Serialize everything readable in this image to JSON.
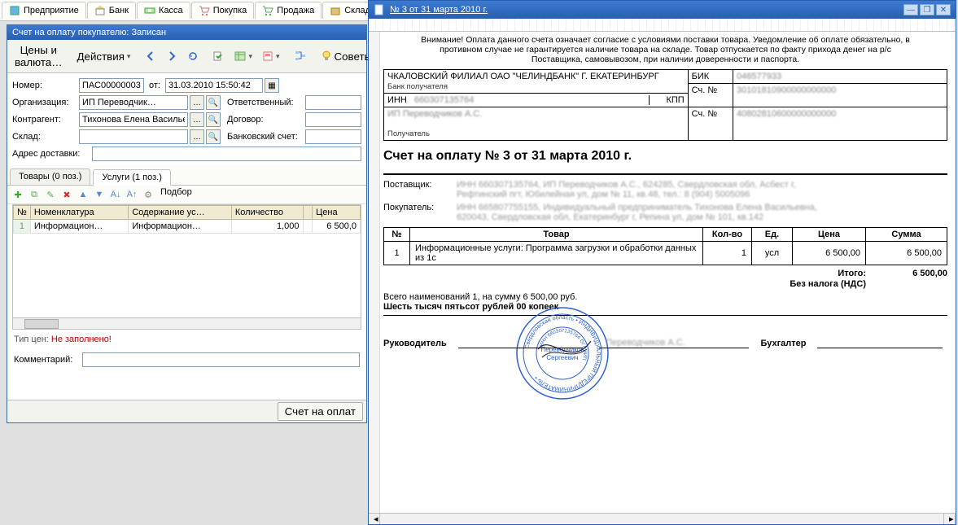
{
  "topTabs": [
    {
      "label": "Предприятие",
      "icon": "building-icon"
    },
    {
      "label": "Банк",
      "icon": "bank-icon"
    },
    {
      "label": "Касса",
      "icon": "cash-icon"
    },
    {
      "label": "Покупка",
      "icon": "cart-icon"
    },
    {
      "label": "Продажа",
      "icon": "sell-icon"
    },
    {
      "label": "Склад",
      "icon": "warehouse-icon"
    }
  ],
  "leftWindow": {
    "title": "Счет на оплату покупателю: Записан",
    "toolbar": {
      "prices": "Цены и валюта…",
      "actions": "Действия",
      "advice": "Советы"
    },
    "form": {
      "numberLabel": "Номер:",
      "numberValue": "ПАС00000003",
      "otLabel": "от:",
      "dateValue": "31.03.2010 15:50:42",
      "orgLabel": "Организация:",
      "orgValue": "ИП Переводчик…",
      "responsibleLabel": "Ответственный:",
      "contragentLabel": "Контрагент:",
      "contragentValue": "Тихонова Елена Васильевна ИП",
      "contractLabel": "Договор:",
      "warehouseLabel": "Склад:",
      "bankAccLabel": "Банковский счет:",
      "addressLabel": "Адрес доставки:"
    },
    "subtabs": {
      "goods": "Товары (0 поз.)",
      "services": "Услуги (1 поз.)"
    },
    "gridToolbar": {
      "selection": "Подбор"
    },
    "gridHeaders": [
      "№",
      "Номенклатура",
      "Содержание ус…",
      "Количество",
      "",
      "Цена"
    ],
    "gridRow": {
      "n": "1",
      "nomen": "Информацион…",
      "content": "Информацион…",
      "qty": "1,000",
      "blank": "",
      "price": "6 500,0"
    },
    "priceTypeLabel": "Тип цен:",
    "priceTypeValue": "Не заполнено!",
    "commentLabel": "Комментарий:",
    "printBtn": "Счет на оплат"
  },
  "rightWindow": {
    "title": "№ 3 от 31 марта 2010 г.",
    "disclaimer": "Внимание! Оплата данного счета означает согласие с условиями поставки товара. Уведомление об оплате обязательно, в противном случае не гарантируется наличие товара на складе. Товар отпускается по факту прихода денег на р/с Поставщика, самовывозом, при наличии доверенности и паспорта.",
    "bank": {
      "bankName": "ЧКАЛОВСКИЙ ФИЛИАЛ ОАО \"ЧЕЛИНДБАНК\" Г. ЕКАТЕРИНБУРГ",
      "bankLabel": "Банк получателя",
      "bikLabel": "БИК",
      "bikValue": "046577933",
      "accLabel": "Сч. №",
      "accValue1": "30101810900000000000",
      "innLabel": "ИНН",
      "innValue": "660307135764",
      "kppLabel": "КПП",
      "accValue2": "40802810600000000000",
      "recipient": "ИП Переводчиков А.С.",
      "recipientLabel": "Получатель"
    },
    "docTitle": "Счет на оплату № 3 от 31 марта 2010 г.",
    "supplier": {
      "label": "Поставщик:",
      "line1": "ИНН 660307135764, ИП Переводчиков А.С., 624285, Свердловская обл, Асбест г,",
      "line2": "Рефтинский пгт, Юбилейная ул, дом № 11, кв.48, тел.: 8 (904) 5005096"
    },
    "buyer": {
      "label": "Покупатель:",
      "line1": "ИНН 665807755155, Индивидуальный предприниматель Тихонова Елена Васильевна,",
      "line2": "620043, Свердловская обл, Екатеринбург г, Репина ул, дом № 101, кв.142"
    },
    "itemsHeaders": [
      "№",
      "Товар",
      "Кол-во",
      "Ед.",
      "Цена",
      "Сумма"
    ],
    "item": {
      "n": "1",
      "name": "Информационные услуги: Программа загрузки и обработки данных из 1с",
      "qty": "1",
      "unit": "усл",
      "price": "6 500,00",
      "sum": "6 500,00"
    },
    "totals": {
      "itogoLabel": "Итого:",
      "itogoValue": "6 500,00",
      "taxLabel": "Без налога (НДС)"
    },
    "summary": "Всего наименований 1, на сумму 6 500,00 руб.",
    "inWords": "Шесть тысяч пятьсот рублей 00 копеек",
    "sig": {
      "director": "Руководитель",
      "directorName": "Переводчиков А.С.",
      "accountant": "Бухгалтер"
    }
  }
}
